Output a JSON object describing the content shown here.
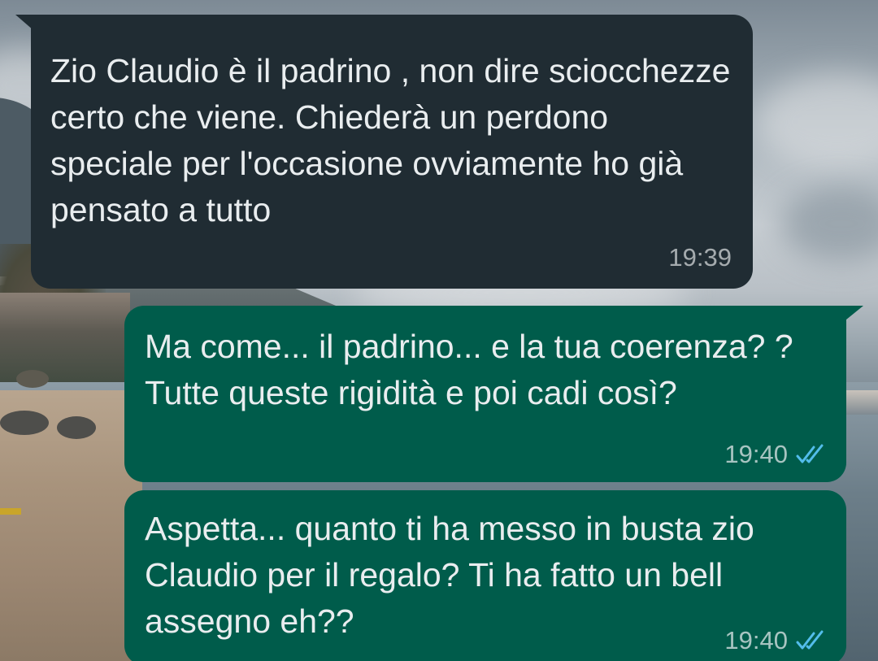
{
  "chat": {
    "messages": [
      {
        "direction": "incoming",
        "text": "Zio Claudio è il padrino , non dire sciocchezze certo che viene. Chiederà un perdono speciale per l'occasione ovviamente ho già pensato a tutto",
        "time": "19:39"
      },
      {
        "direction": "outgoing",
        "text": "Ma come... il padrino... e la tua coerenza? ? Tutte queste rigidità e poi cadi così?",
        "time": "19:40",
        "status_icon": "double-check-read-icon"
      },
      {
        "direction": "outgoing",
        "text": "Aspetta... quanto ti ha messo in busta zio Claudio per il regalo? Ti ha fatto un bell assegno eh??",
        "time": "19:40",
        "status_icon": "double-check-read-icon"
      }
    ]
  },
  "colors": {
    "incoming_bubble": "#202c33",
    "outgoing_bubble": "#005c4b",
    "text": "#e9edef",
    "read_ticks": "#53bdeb"
  }
}
